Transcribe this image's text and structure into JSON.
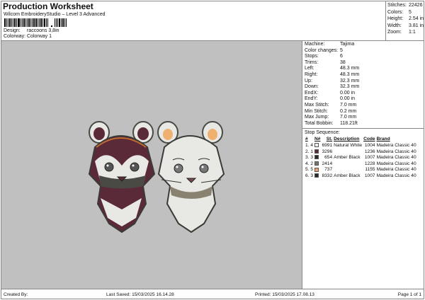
{
  "header": {
    "title": "Production Worksheet",
    "subtitle": "Wilcom EmbroideryStudio – Level 3 Advanced",
    "design_label": "Design:",
    "design": "raccoons 3,8in",
    "colorway_label": "Colorway:",
    "colorway": "Colorway 1"
  },
  "stats": [
    {
      "k": "Stitches:",
      "v": "22426"
    },
    {
      "k": "Colors:",
      "v": "5"
    },
    {
      "k": "Height:",
      "v": "2.54 in"
    },
    {
      "k": "Width:",
      "v": "3.81 in"
    },
    {
      "k": "Zoom:",
      "v": "1:1"
    }
  ],
  "machine": [
    {
      "k": "Machine:",
      "v": "Tajima"
    },
    {
      "k": "Color changes:",
      "v": "5"
    },
    {
      "k": "Stops:",
      "v": "6"
    },
    {
      "k": "Trims:",
      "v": "38"
    },
    {
      "k": "Left:",
      "v": "48.3 mm"
    },
    {
      "k": "Right:",
      "v": "48.3 mm"
    },
    {
      "k": "Up:",
      "v": "32.3 mm"
    },
    {
      "k": "Down:",
      "v": "32.3 mm"
    },
    {
      "k": "EndX:",
      "v": "0.00 in"
    },
    {
      "k": "EndY:",
      "v": "0.00 in"
    },
    {
      "k": "Max Stitch:",
      "v": "7.0 mm"
    },
    {
      "k": "Min Stitch:",
      "v": "0.2 mm"
    },
    {
      "k": "Max Jump:",
      "v": "7.0 mm"
    },
    {
      "k": "Total Bobbin:",
      "v": "118.21ft"
    }
  ],
  "stop_sequence": {
    "title": "Stop Sequence:",
    "headers": [
      "#",
      "N#",
      "St.",
      "Description",
      "Code",
      "Brand"
    ],
    "rows": [
      {
        "n": "1.",
        "nn": "4",
        "color": "#eeeeea",
        "st": "6991",
        "desc": "Natural White",
        "code": "1004",
        "brand": "Madeira Classic 40"
      },
      {
        "n": "2.",
        "nn": "1",
        "color": "#5a2a38",
        "st": "3296",
        "desc": "",
        "code": "1236",
        "brand": "Madeira Classic 40"
      },
      {
        "n": "3.",
        "nn": "3",
        "color": "#2a2a2a",
        "st": "654",
        "desc": "Amber Black",
        "code": "1007",
        "brand": "Madeira Classic 40"
      },
      {
        "n": "4.",
        "nn": "2",
        "color": "#7a7468",
        "st": "2414",
        "desc": "",
        "code": "1228",
        "brand": "Madeira Classic 40"
      },
      {
        "n": "5.",
        "nn": "5",
        "color": "#f0a070",
        "st": "737",
        "desc": "",
        "code": "1155",
        "brand": "Madeira Classic 40"
      },
      {
        "n": "6.",
        "nn": "3",
        "color": "#2a2a2a",
        "st": "8332",
        "desc": "Amber Black",
        "code": "1007",
        "brand": "Madeira Classic 40"
      }
    ]
  },
  "footer": {
    "created": "Created By:",
    "saved": "Last Saved: 15/03/2025 16.14.28",
    "printed": "Printed: 15/03/2025 17.08.13",
    "page": "Page 1 of 1"
  }
}
